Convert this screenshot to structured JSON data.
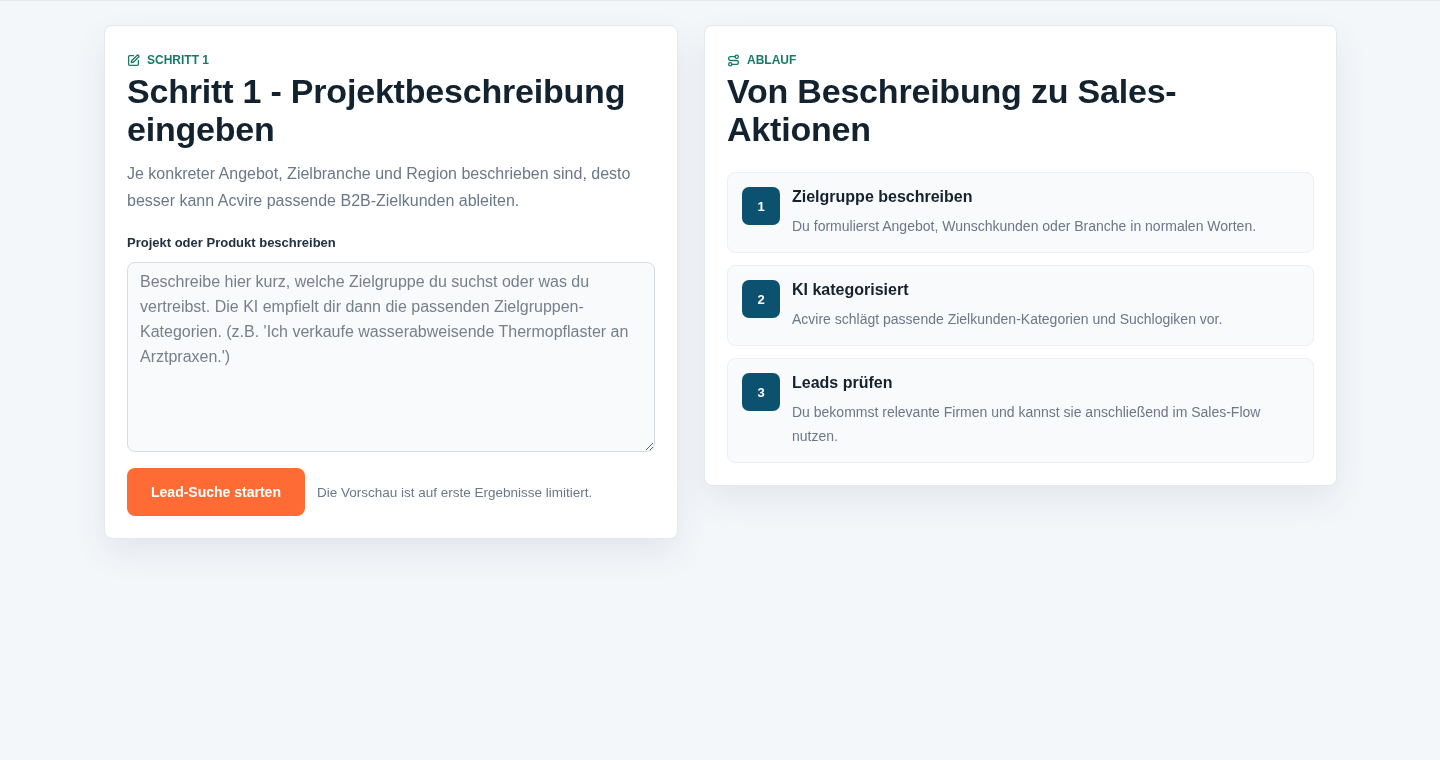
{
  "step_card": {
    "eyebrow": "SCHRITT 1",
    "title": "Schritt 1 - Projektbeschreibung eingeben",
    "description": "Je konkreter Angebot, Zielbranche und Region beschrieben sind, desto besser kann Acvire passende B2B-Zielkunden ableiten.",
    "field_label": "Projekt oder Produkt beschreiben",
    "textarea": {
      "placeholder": "Beschreibe hier kurz, welche Zielgruppe du suchst oder was du vertreibst. Die KI empfielt dir dann die passenden Zielgruppen-Kategorien. (z.B. 'Ich verkaufe wasserabweisende Thermopflaster an Arztpraxen.')"
    },
    "button": "Lead-Suche starten",
    "note": "Die Vorschau ist auf erste Ergebnisse limitiert."
  },
  "flow_card": {
    "eyebrow": "ABLAUF",
    "title": "Von Beschreibung zu Sales-Aktionen",
    "steps": [
      {
        "number": "1",
        "title": "Zielgruppe beschreiben",
        "description": "Du formulierst Angebot, Wunschkunden oder Branche in normalen Worten."
      },
      {
        "number": "2",
        "title": "KI kategorisiert",
        "description": "Acvire schlägt passende Zielkunden-Kategorien und Suchlogiken vor."
      },
      {
        "number": "3",
        "title": "Leads prüfen",
        "description": "Du bekommst relevante Firmen und kannst sie anschließend im Sales-Flow nutzen."
      }
    ]
  }
}
